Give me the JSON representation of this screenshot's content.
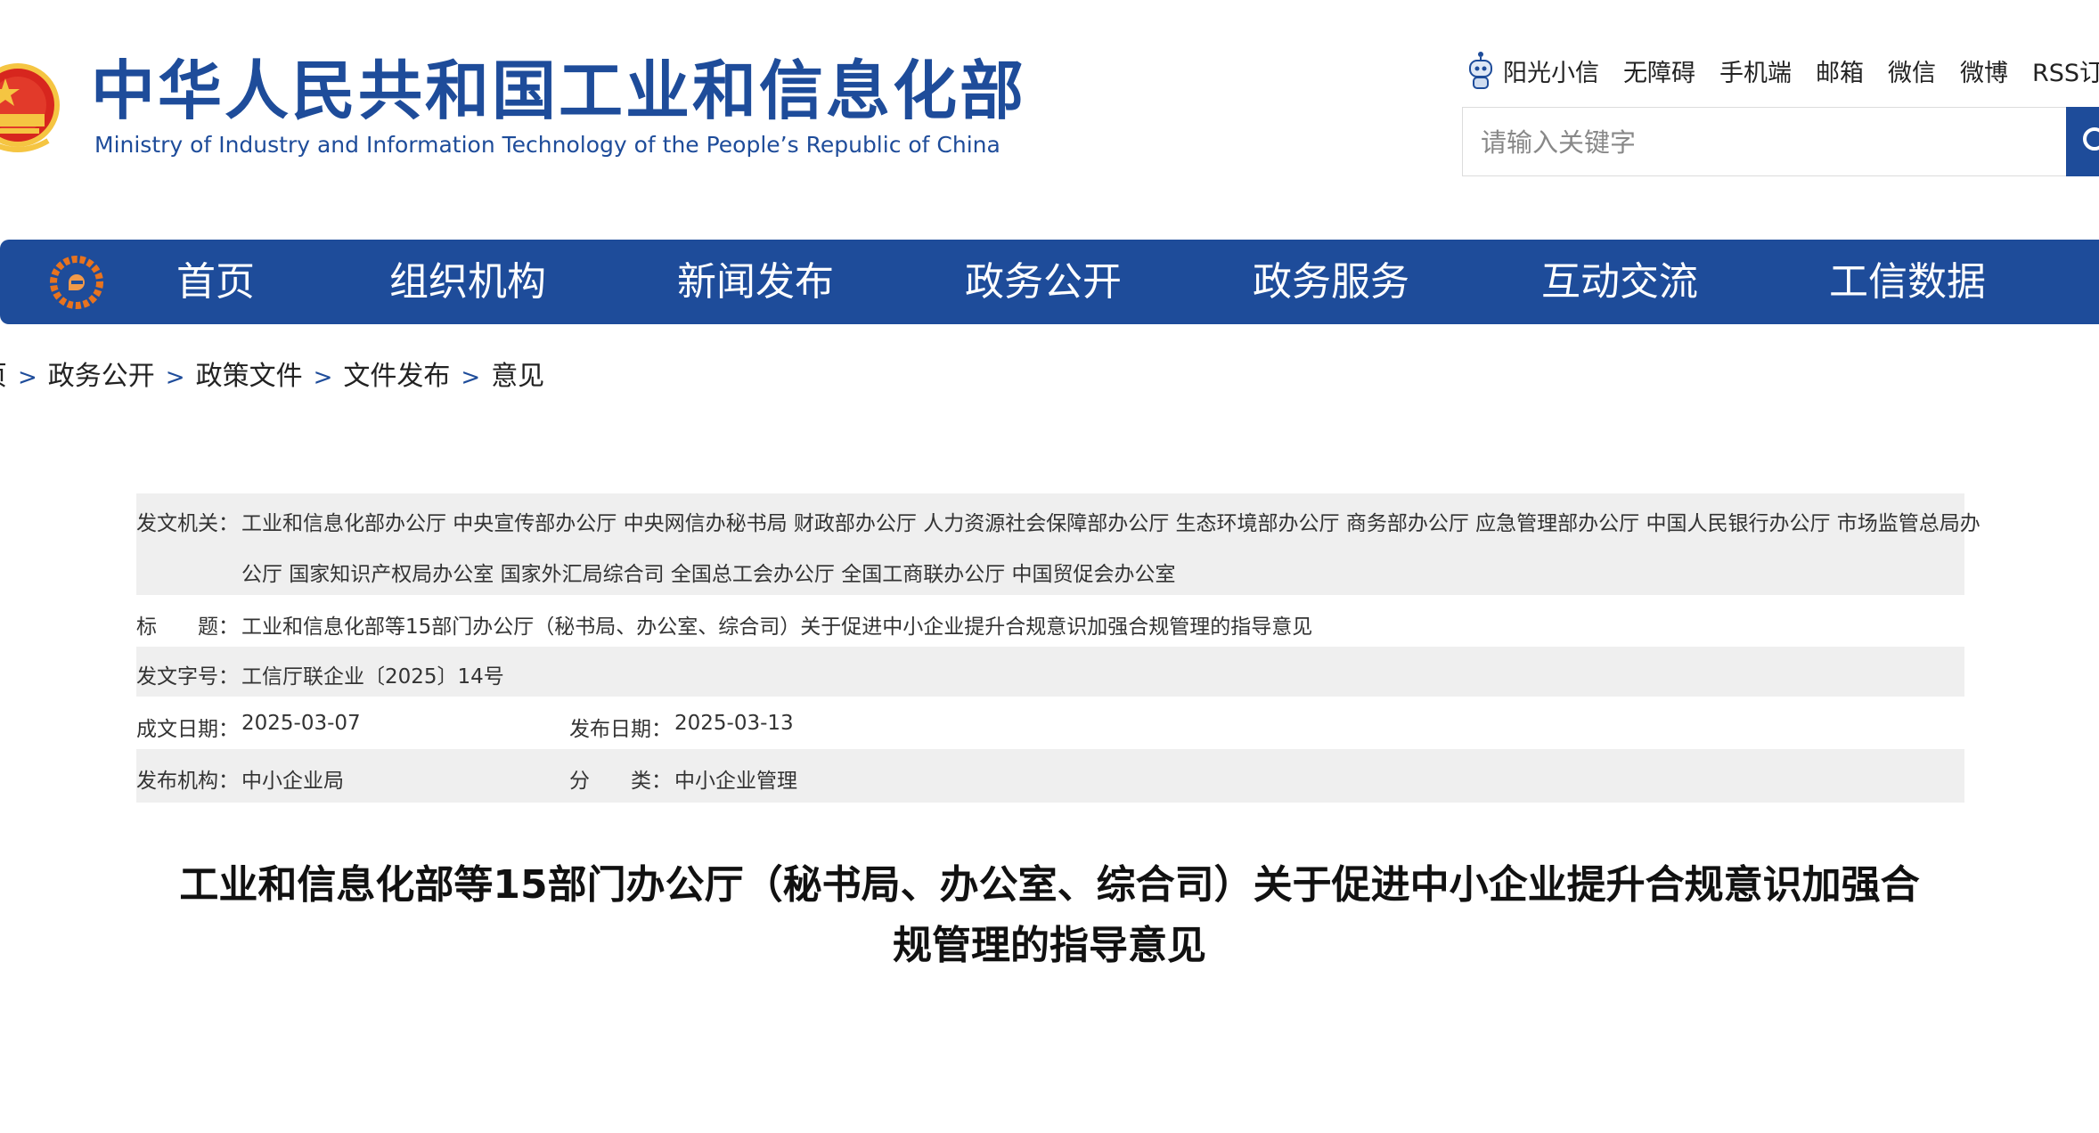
{
  "header": {
    "title_cn": "中华人民共和国工业和信息化部",
    "title_en": "Ministry of Industry and Information Technology of the People’s Republic of China",
    "top_links": [
      "阳光小信",
      "无障碍",
      "手机端",
      "邮箱",
      "微信",
      "微博",
      "RSS订"
    ],
    "search_placeholder": "请输入关键字"
  },
  "nav": {
    "items": [
      "首页",
      "组织机构",
      "新闻发布",
      "政务公开",
      "政务服务",
      "互动交流",
      "工信数据"
    ]
  },
  "breadcrumb": [
    "页",
    "政务公开",
    "政策文件",
    "文件发布",
    "意见"
  ],
  "breadcrumb_separator": ">",
  "info": {
    "issuer_label": "发文机关：",
    "issuer_lines": [
      "工业和信息化部办公厅 中央宣传部办公厅 中央网信办秘书局 财政部办公厅 人力资源社会保障部办公厅 生态环境部办公厅 商务部办公厅 应急管理部办公厅 中国人民银行办公厅 市场监管总局办",
      "公厅 国家知识产权局办公室 国家外汇局综合司 全国总工会办公厅 全国工商联办公厅 中国贸促会办公室"
    ],
    "title_label": "标　　题：",
    "title_value": "工业和信息化部等15部门办公厅（秘书局、办公室、综合司）关于促进中小企业提升合规意识加强合规管理的指导意见",
    "doc_no_label": "发文字号：",
    "doc_no_value": "工信厅联企业〔2025〕14号",
    "written_date_label": "成文日期：",
    "written_date_value": "2025-03-07",
    "publish_date_label": "发布日期：",
    "publish_date_value": "2025-03-13",
    "publisher_label": "发布机构：",
    "publisher_value": "中小企业局",
    "category_label": "分　　类：",
    "category_value": "中小企业管理"
  },
  "article": {
    "title_line1": "工业和信息化部等15部门办公厅（秘书局、办公室、综合司）关于促进中小企业提升合规意识加强合",
    "title_line2": "规管理的指导意见"
  },
  "colors": {
    "brand_blue": "#1e4c9a",
    "emblem_red": "#d7261e",
    "emblem_gold": "#f5c542",
    "row_shade": "#efefef"
  },
  "icons": {
    "emblem": "national-emblem-icon",
    "robot": "robot-assistant-icon",
    "search": "search-icon",
    "nav_logo": "miit-logo-icon"
  }
}
